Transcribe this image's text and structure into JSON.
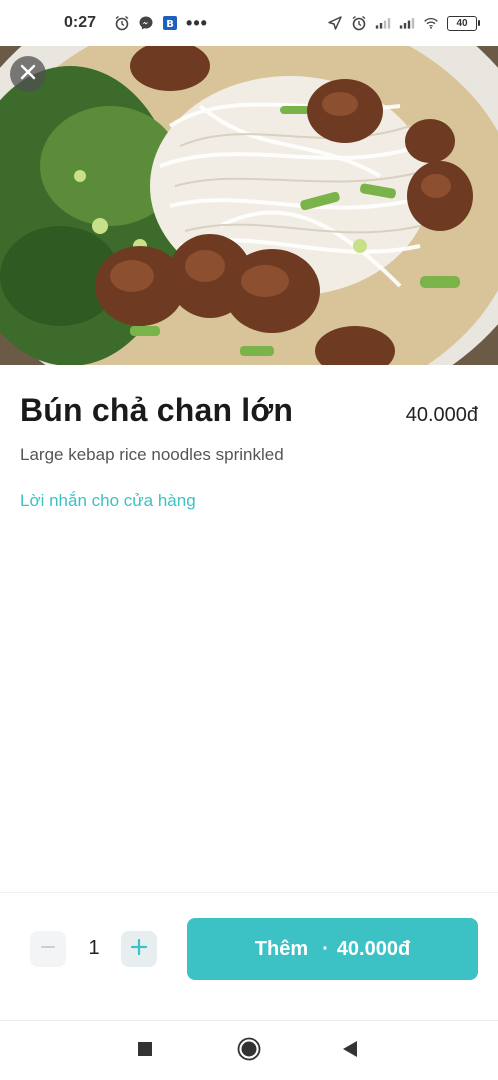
{
  "status_bar": {
    "time": "0:27",
    "overflow": "•••",
    "battery": "40"
  },
  "product": {
    "name": "Bún chả chan lớn",
    "price": "40.000đ",
    "description": "Large kebap rice noodles sprinkled",
    "note_link": "Lời nhắn cho cửa hàng"
  },
  "cart": {
    "quantity": "1",
    "add_label": "Thêm",
    "add_separator": "·",
    "add_total": "40.000đ"
  },
  "colors": {
    "accent": "#3cc2c4",
    "text_primary": "#1a1a1a",
    "text_secondary": "#555555"
  },
  "icons": {
    "close": "close-icon",
    "minus": "minus-icon",
    "plus": "plus-icon",
    "nav_recents": "square-icon",
    "nav_home": "circle-icon",
    "nav_back": "triangle-back-icon"
  }
}
